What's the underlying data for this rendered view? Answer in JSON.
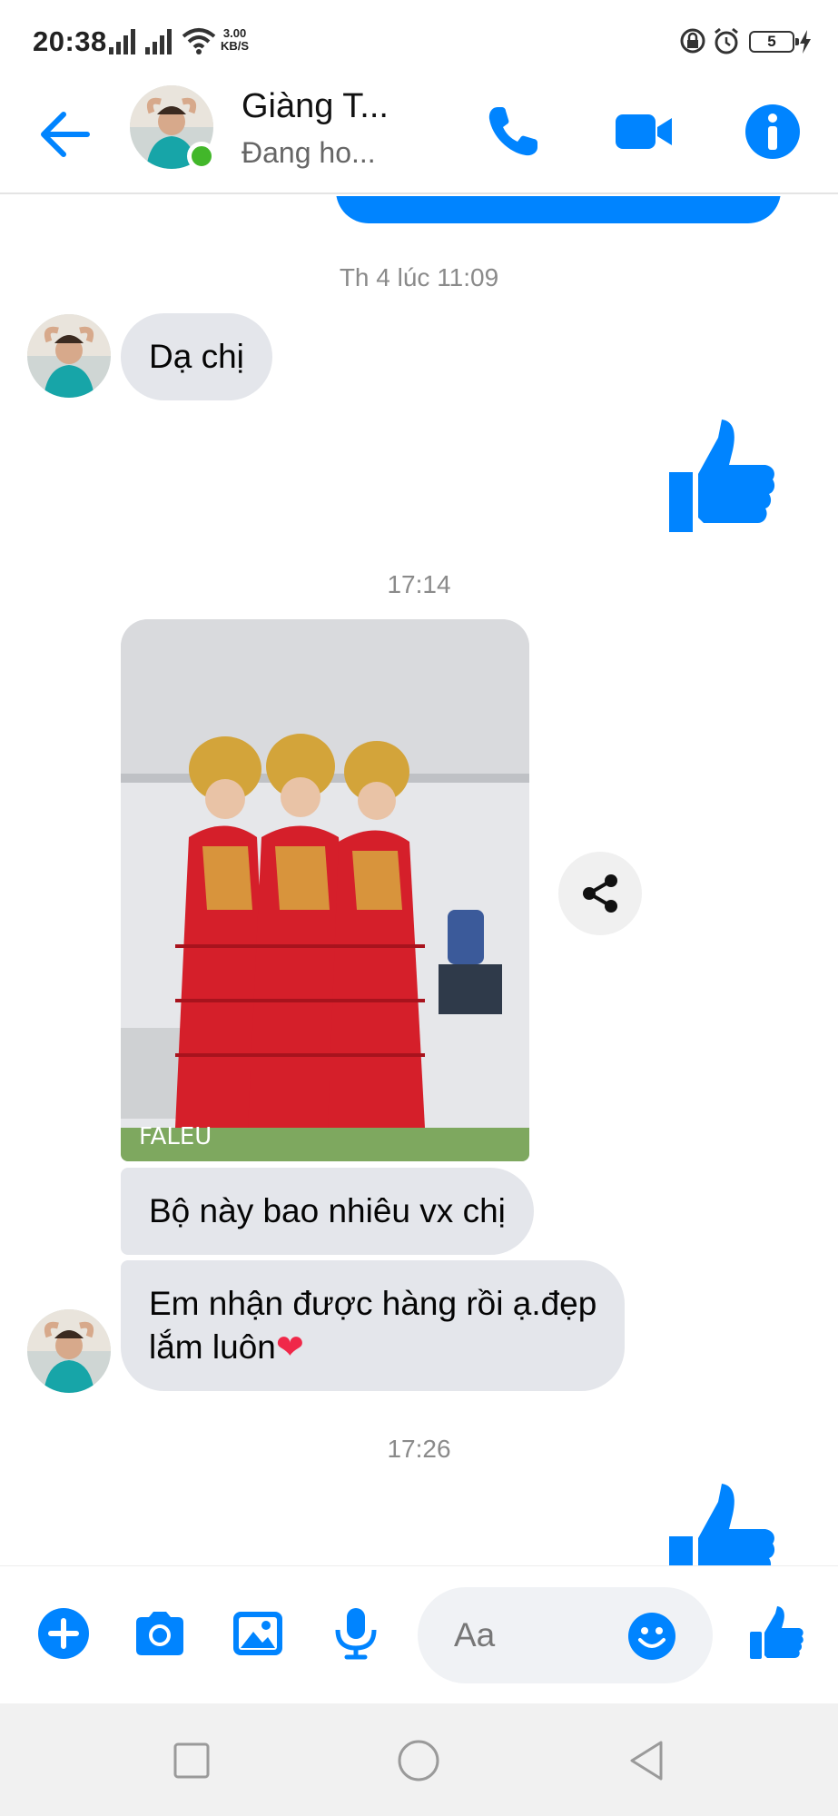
{
  "status_bar": {
    "time": "20:38",
    "net_speed_value": "3.00",
    "net_speed_unit": "KB/S",
    "battery": "5"
  },
  "header": {
    "contact_name": "Giàng T...",
    "contact_status": "Đang ho..."
  },
  "messages": [
    {
      "type": "timestamp",
      "text": "Th 4 lúc 11:09"
    },
    {
      "type": "received",
      "text": "Dạ chị"
    },
    {
      "type": "sent_like"
    },
    {
      "type": "timestamp",
      "text": "17:14"
    },
    {
      "type": "received_photo",
      "watermark": "FALEU"
    },
    {
      "type": "received",
      "text": "Bộ này bao nhiêu vx chị"
    },
    {
      "type": "received",
      "line1": "Em nhận được hàng rồi ạ.đẹp",
      "line2": "lắm luôn",
      "emoji": "❤"
    },
    {
      "type": "timestamp",
      "text": "17:26"
    },
    {
      "type": "sent_like"
    }
  ],
  "composer": {
    "placeholder": "Aa"
  },
  "colors": {
    "accent": "#0084ff",
    "bubble_received": "#e4e6eb",
    "online": "#42b72a",
    "heart": "#f02849"
  },
  "icons": [
    "back-arrow-icon",
    "phone-icon",
    "video-call-icon",
    "info-icon",
    "share-icon",
    "plus-icon",
    "camera-icon",
    "gallery-icon",
    "microphone-icon",
    "emoji-icon",
    "thumbs-up-icon",
    "recents-icon",
    "home-icon",
    "back-icon"
  ]
}
